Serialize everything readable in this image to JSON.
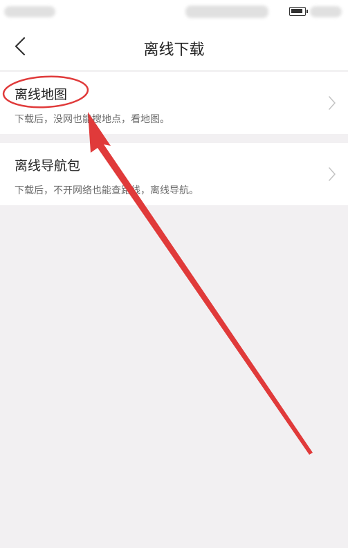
{
  "header": {
    "title": "离线下载"
  },
  "menu": {
    "items": [
      {
        "title": "离线地图",
        "desc": "下载后，没网也能搜地点，看地图。"
      },
      {
        "title": "离线导航包",
        "desc": "下载后，不开网络也能查路线，离线导航。"
      }
    ]
  },
  "icons": {
    "back": "chevron-left-icon",
    "row": "chevron-right-icon"
  },
  "colors": {
    "annotation": "#e03a3a",
    "background": "#f2f0f2",
    "card": "#ffffff"
  }
}
